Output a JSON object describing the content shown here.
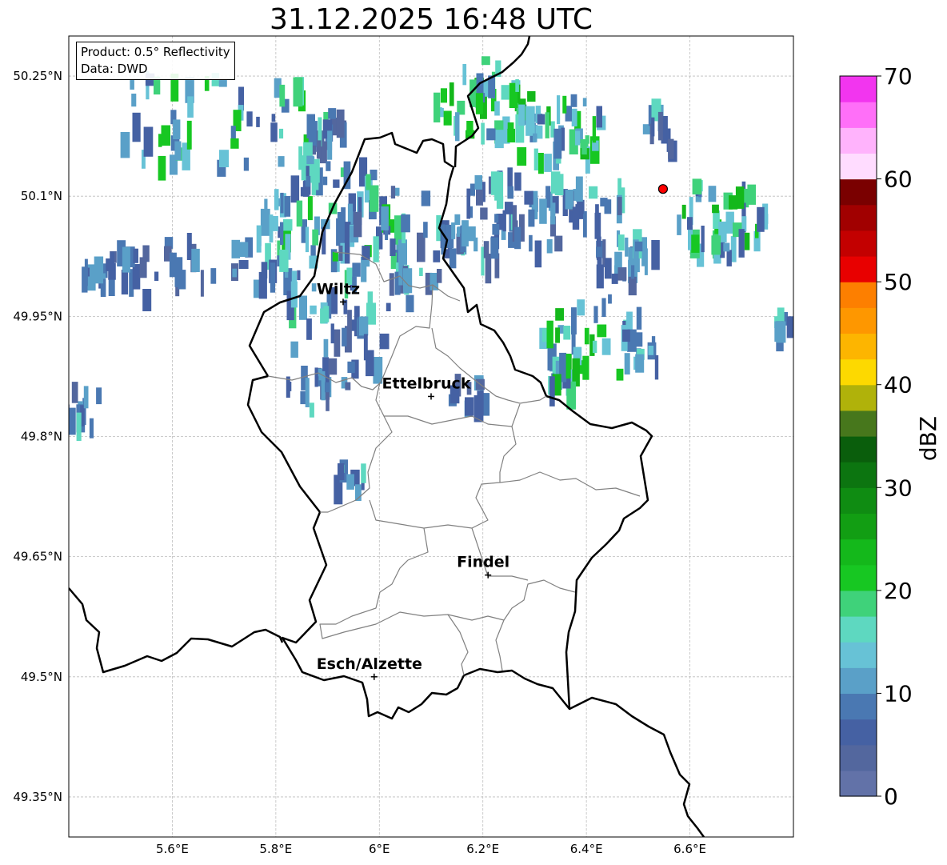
{
  "title": "31.12.2025 16:48 UTC",
  "info": {
    "product": "Product: 0.5° Reflectivity",
    "data": "Data: DWD"
  },
  "map": {
    "lon_range": [
      5.4,
      6.8
    ],
    "lat_range": [
      49.3,
      50.3
    ],
    "grid": true,
    "lon_ticks": [
      {
        "value": 5.6,
        "label": "5.6°E"
      },
      {
        "value": 5.8,
        "label": "5.8°E"
      },
      {
        "value": 6.0,
        "label": "6°E"
      },
      {
        "value": 6.2,
        "label": "6.2°E"
      },
      {
        "value": 6.4,
        "label": "6.4°E"
      },
      {
        "value": 6.6,
        "label": "6.6°E"
      }
    ],
    "lat_ticks": [
      {
        "value": 50.25,
        "label": "50.25°N"
      },
      {
        "value": 50.1,
        "label": "50.1°N"
      },
      {
        "value": 49.95,
        "label": "49.95°N"
      },
      {
        "value": 49.8,
        "label": "49.8°N"
      },
      {
        "value": 49.65,
        "label": "49.65°N"
      },
      {
        "value": 49.5,
        "label": "49.5°N"
      },
      {
        "value": 49.35,
        "label": "49.35°N"
      }
    ],
    "cities": [
      {
        "name": "Wiltz",
        "lon": 5.93,
        "lat": 49.968
      },
      {
        "name": "Ettelbruck",
        "lon": 6.1,
        "lat": 49.85
      },
      {
        "name": "Findel",
        "lon": 6.21,
        "lat": 49.627
      },
      {
        "name": "Esch/Alzette",
        "lon": 5.99,
        "lat": 49.5
      }
    ],
    "radar_site": {
      "lon": 6.548,
      "lat": 50.109,
      "color": "#ff0000"
    }
  },
  "colorbar": {
    "label": "dBZ",
    "min": 0,
    "max": 70,
    "ticks": [
      0,
      10,
      20,
      30,
      40,
      50,
      60,
      70
    ],
    "colors": [
      "#6272a8",
      "#53679e",
      "#4561a3",
      "#4a78b2",
      "#5aa0c8",
      "#67c2d6",
      "#5ed8c0",
      "#3fd27a",
      "#17c722",
      "#14b81b",
      "#129e13",
      "#0f8c12",
      "#0c7510",
      "#0a5e0c",
      "#47771c",
      "#b0b20a",
      "#fdd900",
      "#fdb500",
      "#fe9700",
      "#fd7f00",
      "#e80000",
      "#c30000",
      "#a10000",
      "#7a0000",
      "#ffdcff",
      "#ffb3fc",
      "#ff6ff8",
      "#f235ef"
    ]
  }
}
